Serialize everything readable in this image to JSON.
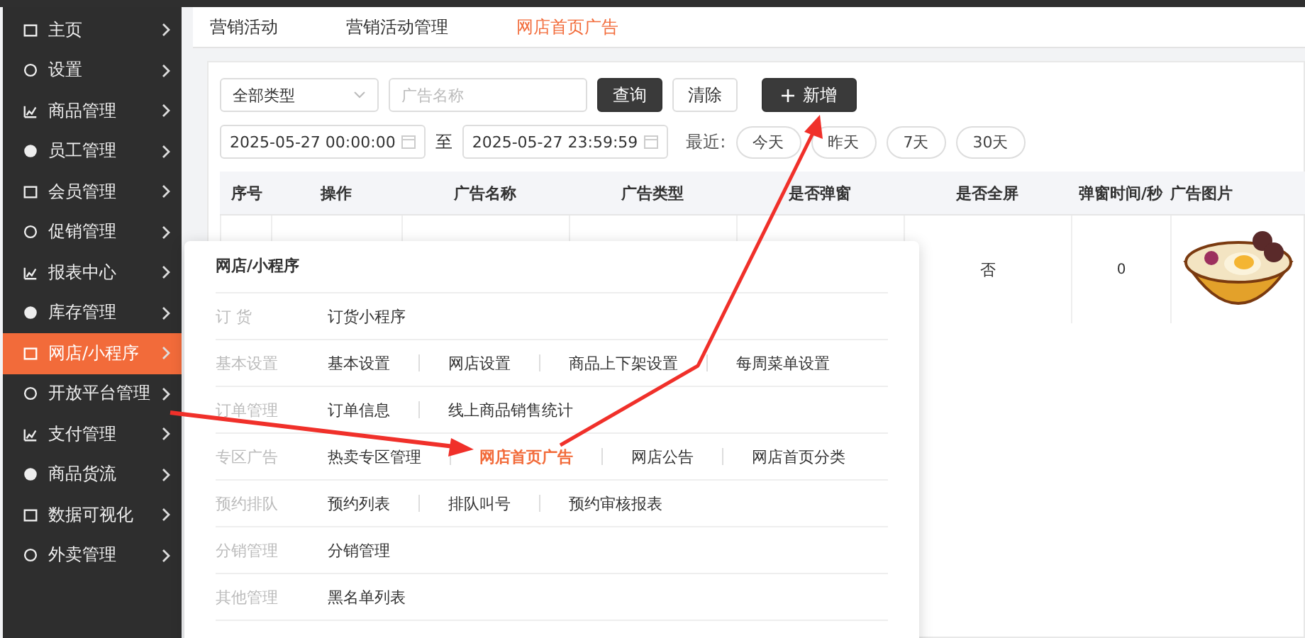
{
  "sidebar": {
    "items": [
      {
        "label": "主页",
        "selected": false
      },
      {
        "label": "设置",
        "selected": false
      },
      {
        "label": "商品管理",
        "selected": false
      },
      {
        "label": "员工管理",
        "selected": false
      },
      {
        "label": "会员管理",
        "selected": false
      },
      {
        "label": "促销管理",
        "selected": false
      },
      {
        "label": "报表中心",
        "selected": false
      },
      {
        "label": "库存管理",
        "selected": false
      },
      {
        "label": "网店/小程序",
        "selected": true
      },
      {
        "label": "开放平台管理",
        "selected": false
      },
      {
        "label": "支付管理",
        "selected": false
      },
      {
        "label": "商品货流",
        "selected": false
      },
      {
        "label": "数据可视化",
        "selected": false
      },
      {
        "label": "外卖管理",
        "selected": false
      }
    ]
  },
  "tabs": [
    {
      "label": "营销活动",
      "selected": false
    },
    {
      "label": "营销活动管理",
      "selected": false
    },
    {
      "label": "网店首页广告",
      "selected": true
    }
  ],
  "filters": {
    "type_select": "全部类型",
    "name_field": {
      "placeholder": "广告名称"
    },
    "query_button": "查询",
    "clear_button": "清除",
    "add_button": "新增",
    "start_date": "2025-05-27 00:00:00",
    "separator": "至",
    "end_date": "2025-05-27 23:59:59",
    "recent_label": "最近:",
    "recent_buttons": [
      "今天",
      "昨天",
      "7天",
      "30天"
    ]
  },
  "table": {
    "columns": [
      "序号",
      "操作",
      "广告名称",
      "广告类型",
      "是否弹窗",
      "是否全屏",
      "弹窗时间/秒",
      "广告图片"
    ],
    "rows": [
      {
        "fullscreen": "否",
        "popup_seconds": "0"
      }
    ]
  },
  "popup": {
    "title": "网店/小程序",
    "groups": [
      {
        "label": "订 货",
        "links": [
          {
            "label": "订货小程序",
            "selected": false
          }
        ]
      },
      {
        "label": "基本设置",
        "links": [
          {
            "label": "基本设置",
            "selected": false
          },
          {
            "label": "网店设置",
            "selected": false
          },
          {
            "label": "商品上下架设置",
            "selected": false
          },
          {
            "label": "每周菜单设置",
            "selected": false
          }
        ]
      },
      {
        "label": "订单管理",
        "links": [
          {
            "label": "订单信息",
            "selected": false
          },
          {
            "label": "线上商品销售统计",
            "selected": false
          }
        ]
      },
      {
        "label": "专区广告",
        "links": [
          {
            "label": "热卖专区管理",
            "selected": false
          },
          {
            "label": "网店首页广告",
            "selected": true
          },
          {
            "label": "网店公告",
            "selected": false
          },
          {
            "label": "网店首页分类",
            "selected": false
          }
        ]
      },
      {
        "label": "预约排队",
        "links": [
          {
            "label": "预约列表",
            "selected": false
          },
          {
            "label": "排队叫号",
            "selected": false
          },
          {
            "label": "预约审核报表",
            "selected": false
          }
        ]
      },
      {
        "label": "分销管理",
        "links": [
          {
            "label": "分销管理",
            "selected": false
          }
        ]
      },
      {
        "label": "其他管理",
        "links": [
          {
            "label": "黑名单列表",
            "selected": false
          }
        ]
      }
    ]
  }
}
